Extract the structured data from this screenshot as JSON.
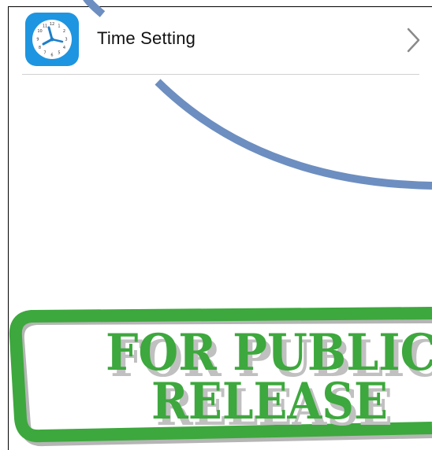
{
  "settings_row": {
    "label": "Time Setting",
    "icon": "clock-icon",
    "chevron": "chevron-right-icon"
  },
  "stamp": {
    "line1": "FOR PUBLIC",
    "line2": "RELEASE",
    "color": "#3da83d"
  },
  "colors": {
    "icon_background": "#1e95e0",
    "arc": "#6d8ec0"
  }
}
